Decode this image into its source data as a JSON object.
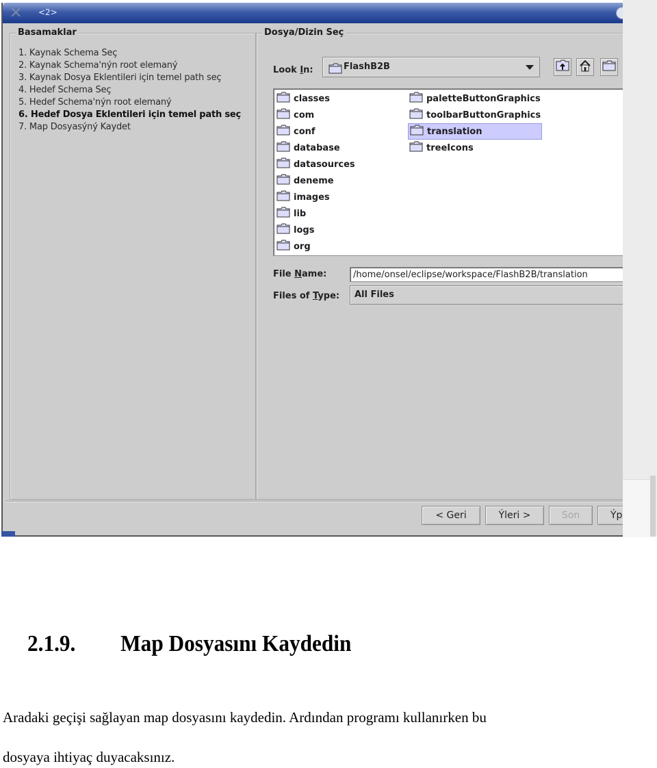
{
  "window": {
    "title": "<2>",
    "steps_title": "Basamaklar",
    "steps": [
      {
        "label": "1. Kaynak Schema Seç",
        "current": false
      },
      {
        "label": "2. Kaynak Schema'nýn root elemaný",
        "current": false
      },
      {
        "label": "3. Kaynak Dosya Eklentileri için temel path seç",
        "current": false
      },
      {
        "label": "4. Hedef Schema Seç",
        "current": false
      },
      {
        "label": "5. Hedef Schema'nýn root elemaný",
        "current": false
      },
      {
        "label": "6. Hedef Dosya Eklentileri için temel path seç",
        "current": true
      },
      {
        "label": "7. Map Dosyasýný Kaydet",
        "current": false
      }
    ],
    "chooser": {
      "title": "Dosya/Dizin Seç",
      "look_in_label_pre": "Look ",
      "look_in_label_mn": "I",
      "look_in_label_post": "n:",
      "look_in_value": "FlashB2B",
      "toolbar": {
        "up_folder": "up-one-level",
        "home": "home",
        "new_folder": "new-folder"
      },
      "files_col1": [
        "classes",
        "com",
        "conf",
        "database",
        "datasources",
        "deneme",
        "images",
        "lib",
        "logs",
        "org"
      ],
      "files_col2": [
        "paletteButtonGraphics",
        "toolbarButtonGraphics",
        "translation",
        "treeIcons"
      ],
      "selected_file": "translation",
      "file_name_label_pre": "File ",
      "file_name_label_mn": "N",
      "file_name_label_post": "ame:",
      "file_name_value": "/home/onsel/eclipse/workspace/FlashB2B/translation",
      "file_type_label_pre": "Files of ",
      "file_type_label_mn": "T",
      "file_type_label_post": "ype:",
      "file_type_value": "All Files"
    },
    "buttons": {
      "back": "< Geri",
      "next": "Ýleri >",
      "finish": "Son",
      "cancel": "Ýp"
    },
    "colors": {
      "selection": "#ccccff",
      "titlebar": "#1c3a8c",
      "panel": "#cdcdcd"
    }
  },
  "document": {
    "heading_number": "2.1.9.",
    "heading_text": "Map Dosyasını Kaydedin",
    "paragraph_line1": "Aradaki geçişi sağlayan map dosyasını kaydedin. Ardından programı kullanırken bu",
    "paragraph_line2": "dosyaya ihtiyaç duyacaksınız."
  }
}
